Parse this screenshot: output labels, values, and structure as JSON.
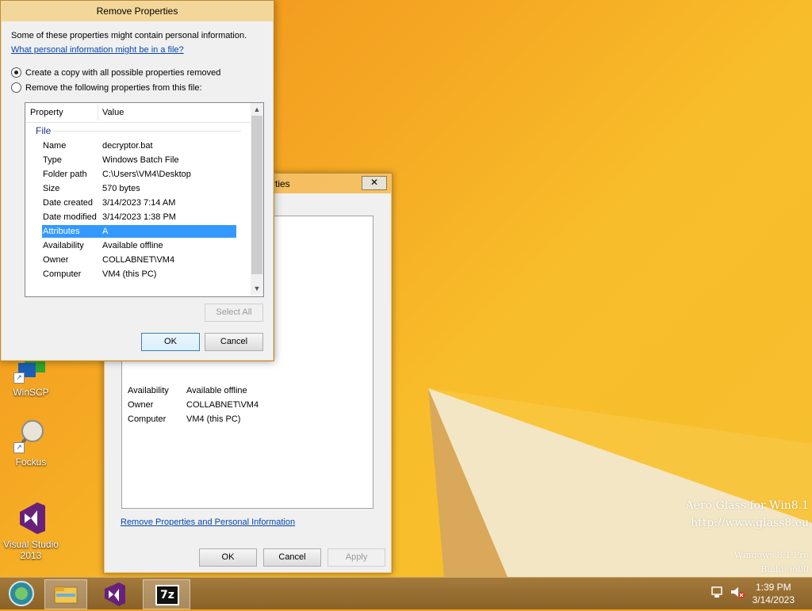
{
  "desktop": {
    "watermark": {
      "line1": "Aero Glass for Win8.1",
      "line2": "http://www.glass8.eu",
      "line3": "Windows 8.1 Pro",
      "line4": "Build 9600"
    },
    "icons": [
      {
        "label": "WinSCP",
        "icon": "winscp-icon"
      },
      {
        "label": "Fockus",
        "icon": "magnifier-icon"
      },
      {
        "label": "Visual Studio 2013",
        "icon": "visual-studio-icon"
      }
    ]
  },
  "properties_window": {
    "title": "rties",
    "close_label": "✕",
    "rows": [
      {
        "key": "Availability",
        "value": "Available offline"
      },
      {
        "key": "Owner",
        "value": "COLLABNET\\VM4"
      },
      {
        "key": "Computer",
        "value": "VM4 (this PC)"
      }
    ],
    "link": "Remove Properties and Personal Information",
    "buttons": {
      "ok": "OK",
      "cancel": "Cancel",
      "apply": "Apply"
    }
  },
  "remove_dialog": {
    "title": "Remove Properties",
    "intro": "Some of these properties might contain personal information.",
    "info_link": "What personal information might be in a file?",
    "options": [
      {
        "label": "Create a copy with all possible properties removed",
        "checked": true
      },
      {
        "label": "Remove the following properties from this file:",
        "checked": false
      }
    ],
    "list": {
      "columns": [
        "Property",
        "Value"
      ],
      "group": "File",
      "rows": [
        {
          "key": "Name",
          "value": "decryptor.bat",
          "selected": false
        },
        {
          "key": "Type",
          "value": "Windows Batch File",
          "selected": false
        },
        {
          "key": "Folder path",
          "value": "C:\\Users\\VM4\\Desktop",
          "selected": false
        },
        {
          "key": "Size",
          "value": "570 bytes",
          "selected": false
        },
        {
          "key": "Date created",
          "value": "3/14/2023 7:14 AM",
          "selected": false
        },
        {
          "key": "Date modified",
          "value": "3/14/2023 1:38 PM",
          "selected": false
        },
        {
          "key": "Attributes",
          "value": "A",
          "selected": true
        },
        {
          "key": "Availability",
          "value": "Available offline",
          "selected": false
        },
        {
          "key": "Owner",
          "value": "COLLABNET\\VM4",
          "selected": false
        },
        {
          "key": "Computer",
          "value": "VM4 (this PC)",
          "selected": false
        }
      ]
    },
    "buttons": {
      "select_all": "Select All",
      "ok": "OK",
      "cancel": "Cancel"
    }
  },
  "taskbar": {
    "items": [
      "start-orb-icon",
      "file-explorer-icon",
      "visual-studio-icon",
      "7zip-icon"
    ],
    "sevenzip_label": "7z",
    "time": "1:39 PM",
    "date": "3/14/2023"
  }
}
